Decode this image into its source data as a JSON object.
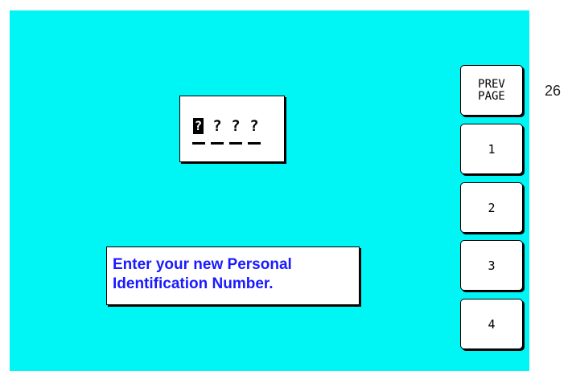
{
  "pin_entry": {
    "digits": [
      {
        "char": "?",
        "active": true
      },
      {
        "char": "?",
        "active": false
      },
      {
        "char": "?",
        "active": false
      },
      {
        "char": "?",
        "active": false
      }
    ]
  },
  "message": {
    "line1": "Enter your new Personal",
    "line2": "Identification Number."
  },
  "side_buttons": {
    "prev_page": "PREV\nPAGE",
    "b1": "1",
    "b2": "2",
    "b3": "3",
    "b4": "4"
  },
  "page_number": "26",
  "colors": {
    "screen_background": "#00f5f5",
    "message_text": "#1a1aff"
  }
}
